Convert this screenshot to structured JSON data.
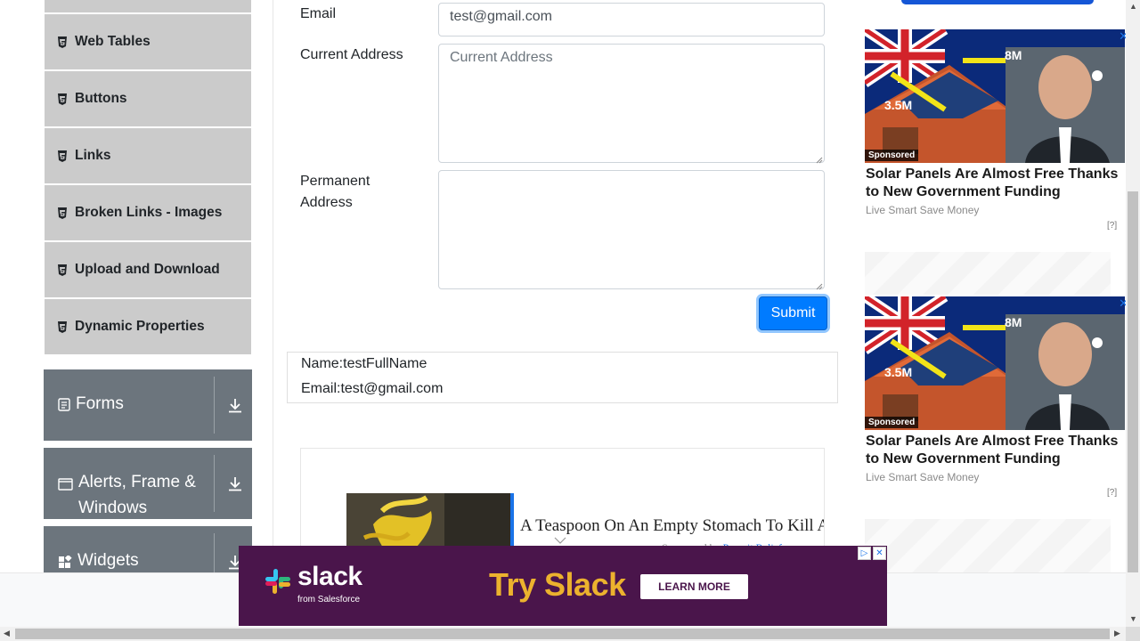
{
  "sidebar": {
    "items": [
      {
        "label": "Web Tables"
      },
      {
        "label": "Buttons"
      },
      {
        "label": "Links"
      },
      {
        "label": "Broken Links - Images"
      },
      {
        "label": "Upload and Download"
      },
      {
        "label": "Dynamic Properties"
      }
    ],
    "groups": [
      {
        "label": "Forms"
      },
      {
        "label": "Alerts, Frame &",
        "label2": "Windows"
      },
      {
        "label": "Widgets"
      }
    ]
  },
  "form": {
    "email_label": "Email",
    "email_value": "test@gmail.com",
    "current_address_label": "Current Address",
    "current_address_placeholder": "Current Address",
    "permanent_address_label_1": "Permanent",
    "permanent_address_label_2": "Address",
    "submit_label": "Submit"
  },
  "output": {
    "name": "Name:testFullName",
    "email": "Email:test@gmail.com"
  },
  "content_ad": {
    "title": "A Teaspoon On An Empty Stomach To Kill Al",
    "sub_prefix": "Sponsored by",
    "sub_source": "Prosvit Relief"
  },
  "right_ads": [
    {
      "sponsored": "Sponsored",
      "title": "Solar Panels Are Almost Free Thanks to New Government Funding",
      "source": "Live Smart Save Money",
      "q": "[?]",
      "overlay_a": "8M",
      "overlay_b": "3.5M"
    },
    {
      "sponsored": "Sponsored",
      "title": "Solar Panels Are Almost Free Thanks to New Government Funding",
      "source": "Live Smart Save Money",
      "q": "[?]",
      "overlay_a": "8M",
      "overlay_b": "3.5M"
    }
  ],
  "banner": {
    "brand": "slack",
    "from": "from Salesforce",
    "headline": "Try Slack",
    "cta": "LEARN MORE"
  },
  "colors": {
    "submit_bg": "#007bff",
    "sidebar_item_bg": "#cbcbcb",
    "group_bg": "#6c757d",
    "banner_bg": "#4a154b",
    "banner_headline": "#ecb22e"
  }
}
